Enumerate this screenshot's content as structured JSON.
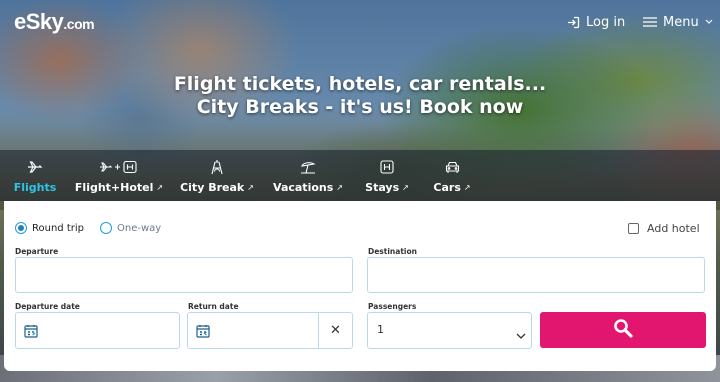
{
  "header": {
    "logo_text": "eSky",
    "logo_suffix": ".com",
    "login_label": "Log in",
    "menu_label": "Menu"
  },
  "hero": {
    "headline_line1": "Flight tickets, hotels, car rentals...",
    "headline_line2": "City Breaks - it's us! Book now"
  },
  "tabs": [
    {
      "label": "Flights",
      "icon": "plane-icon",
      "active": true
    },
    {
      "label": "Flight+Hotel",
      "icon": "plane-plus-hotel-icon",
      "external": true
    },
    {
      "label": "City Break",
      "icon": "eiffel-tower-icon",
      "external": true
    },
    {
      "label": "Vacations",
      "icon": "beach-umbrella-icon",
      "external": true
    },
    {
      "label": "Stays",
      "icon": "hotel-icon",
      "external": true
    },
    {
      "label": "Cars",
      "icon": "car-icon",
      "external": true
    }
  ],
  "search": {
    "trip_type": {
      "options": [
        {
          "label": "Round trip",
          "selected": true
        },
        {
          "label": "One-way",
          "selected": false
        }
      ]
    },
    "add_hotel_label": "Add hotel",
    "add_hotel_checked": false,
    "departure_label": "Departure",
    "departure_value": "",
    "destination_label": "Destination",
    "destination_value": "",
    "departure_date_label": "Departure date",
    "return_date_label": "Return date",
    "clear_symbol": "✕",
    "passengers_label": "Passengers",
    "passengers_value": "1"
  },
  "colors": {
    "accent_cyan": "#2fc4e6",
    "search_button": "#e2166e",
    "radio_blue": "#1f7fc4",
    "field_border": "#b9dbe9"
  }
}
